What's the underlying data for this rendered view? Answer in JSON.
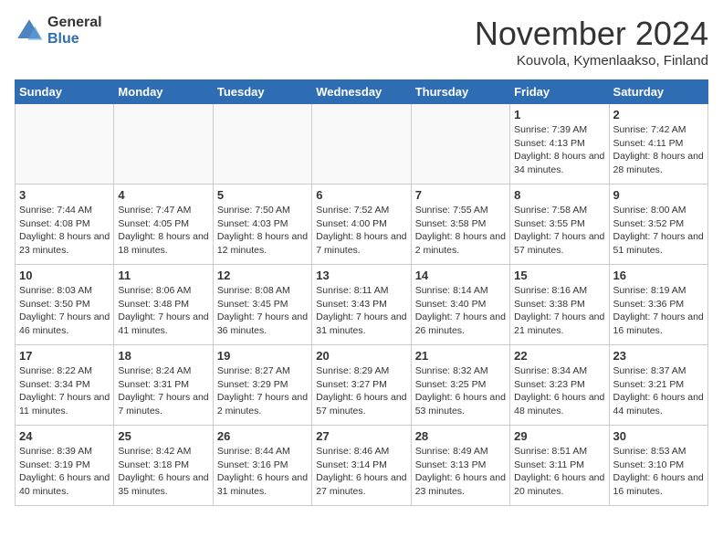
{
  "logo": {
    "general": "General",
    "blue": "Blue"
  },
  "header": {
    "month": "November 2024",
    "location": "Kouvola, Kymenlaakso, Finland"
  },
  "weekdays": [
    "Sunday",
    "Monday",
    "Tuesday",
    "Wednesday",
    "Thursday",
    "Friday",
    "Saturday"
  ],
  "weeks": [
    [
      {
        "day": "",
        "sunrise": "",
        "sunset": "",
        "daylight": ""
      },
      {
        "day": "",
        "sunrise": "",
        "sunset": "",
        "daylight": ""
      },
      {
        "day": "",
        "sunrise": "",
        "sunset": "",
        "daylight": ""
      },
      {
        "day": "",
        "sunrise": "",
        "sunset": "",
        "daylight": ""
      },
      {
        "day": "",
        "sunrise": "",
        "sunset": "",
        "daylight": ""
      },
      {
        "day": "1",
        "sunrise": "Sunrise: 7:39 AM",
        "sunset": "Sunset: 4:13 PM",
        "daylight": "Daylight: 8 hours and 34 minutes."
      },
      {
        "day": "2",
        "sunrise": "Sunrise: 7:42 AM",
        "sunset": "Sunset: 4:11 PM",
        "daylight": "Daylight: 8 hours and 28 minutes."
      }
    ],
    [
      {
        "day": "3",
        "sunrise": "Sunrise: 7:44 AM",
        "sunset": "Sunset: 4:08 PM",
        "daylight": "Daylight: 8 hours and 23 minutes."
      },
      {
        "day": "4",
        "sunrise": "Sunrise: 7:47 AM",
        "sunset": "Sunset: 4:05 PM",
        "daylight": "Daylight: 8 hours and 18 minutes."
      },
      {
        "day": "5",
        "sunrise": "Sunrise: 7:50 AM",
        "sunset": "Sunset: 4:03 PM",
        "daylight": "Daylight: 8 hours and 12 minutes."
      },
      {
        "day": "6",
        "sunrise": "Sunrise: 7:52 AM",
        "sunset": "Sunset: 4:00 PM",
        "daylight": "Daylight: 8 hours and 7 minutes."
      },
      {
        "day": "7",
        "sunrise": "Sunrise: 7:55 AM",
        "sunset": "Sunset: 3:58 PM",
        "daylight": "Daylight: 8 hours and 2 minutes."
      },
      {
        "day": "8",
        "sunrise": "Sunrise: 7:58 AM",
        "sunset": "Sunset: 3:55 PM",
        "daylight": "Daylight: 7 hours and 57 minutes."
      },
      {
        "day": "9",
        "sunrise": "Sunrise: 8:00 AM",
        "sunset": "Sunset: 3:52 PM",
        "daylight": "Daylight: 7 hours and 51 minutes."
      }
    ],
    [
      {
        "day": "10",
        "sunrise": "Sunrise: 8:03 AM",
        "sunset": "Sunset: 3:50 PM",
        "daylight": "Daylight: 7 hours and 46 minutes."
      },
      {
        "day": "11",
        "sunrise": "Sunrise: 8:06 AM",
        "sunset": "Sunset: 3:48 PM",
        "daylight": "Daylight: 7 hours and 41 minutes."
      },
      {
        "day": "12",
        "sunrise": "Sunrise: 8:08 AM",
        "sunset": "Sunset: 3:45 PM",
        "daylight": "Daylight: 7 hours and 36 minutes."
      },
      {
        "day": "13",
        "sunrise": "Sunrise: 8:11 AM",
        "sunset": "Sunset: 3:43 PM",
        "daylight": "Daylight: 7 hours and 31 minutes."
      },
      {
        "day": "14",
        "sunrise": "Sunrise: 8:14 AM",
        "sunset": "Sunset: 3:40 PM",
        "daylight": "Daylight: 7 hours and 26 minutes."
      },
      {
        "day": "15",
        "sunrise": "Sunrise: 8:16 AM",
        "sunset": "Sunset: 3:38 PM",
        "daylight": "Daylight: 7 hours and 21 minutes."
      },
      {
        "day": "16",
        "sunrise": "Sunrise: 8:19 AM",
        "sunset": "Sunset: 3:36 PM",
        "daylight": "Daylight: 7 hours and 16 minutes."
      }
    ],
    [
      {
        "day": "17",
        "sunrise": "Sunrise: 8:22 AM",
        "sunset": "Sunset: 3:34 PM",
        "daylight": "Daylight: 7 hours and 11 minutes."
      },
      {
        "day": "18",
        "sunrise": "Sunrise: 8:24 AM",
        "sunset": "Sunset: 3:31 PM",
        "daylight": "Daylight: 7 hours and 7 minutes."
      },
      {
        "day": "19",
        "sunrise": "Sunrise: 8:27 AM",
        "sunset": "Sunset: 3:29 PM",
        "daylight": "Daylight: 7 hours and 2 minutes."
      },
      {
        "day": "20",
        "sunrise": "Sunrise: 8:29 AM",
        "sunset": "Sunset: 3:27 PM",
        "daylight": "Daylight: 6 hours and 57 minutes."
      },
      {
        "day": "21",
        "sunrise": "Sunrise: 8:32 AM",
        "sunset": "Sunset: 3:25 PM",
        "daylight": "Daylight: 6 hours and 53 minutes."
      },
      {
        "day": "22",
        "sunrise": "Sunrise: 8:34 AM",
        "sunset": "Sunset: 3:23 PM",
        "daylight": "Daylight: 6 hours and 48 minutes."
      },
      {
        "day": "23",
        "sunrise": "Sunrise: 8:37 AM",
        "sunset": "Sunset: 3:21 PM",
        "daylight": "Daylight: 6 hours and 44 minutes."
      }
    ],
    [
      {
        "day": "24",
        "sunrise": "Sunrise: 8:39 AM",
        "sunset": "Sunset: 3:19 PM",
        "daylight": "Daylight: 6 hours and 40 minutes."
      },
      {
        "day": "25",
        "sunrise": "Sunrise: 8:42 AM",
        "sunset": "Sunset: 3:18 PM",
        "daylight": "Daylight: 6 hours and 35 minutes."
      },
      {
        "day": "26",
        "sunrise": "Sunrise: 8:44 AM",
        "sunset": "Sunset: 3:16 PM",
        "daylight": "Daylight: 6 hours and 31 minutes."
      },
      {
        "day": "27",
        "sunrise": "Sunrise: 8:46 AM",
        "sunset": "Sunset: 3:14 PM",
        "daylight": "Daylight: 6 hours and 27 minutes."
      },
      {
        "day": "28",
        "sunrise": "Sunrise: 8:49 AM",
        "sunset": "Sunset: 3:13 PM",
        "daylight": "Daylight: 6 hours and 23 minutes."
      },
      {
        "day": "29",
        "sunrise": "Sunrise: 8:51 AM",
        "sunset": "Sunset: 3:11 PM",
        "daylight": "Daylight: 6 hours and 20 minutes."
      },
      {
        "day": "30",
        "sunrise": "Sunrise: 8:53 AM",
        "sunset": "Sunset: 3:10 PM",
        "daylight": "Daylight: 6 hours and 16 minutes."
      }
    ]
  ]
}
